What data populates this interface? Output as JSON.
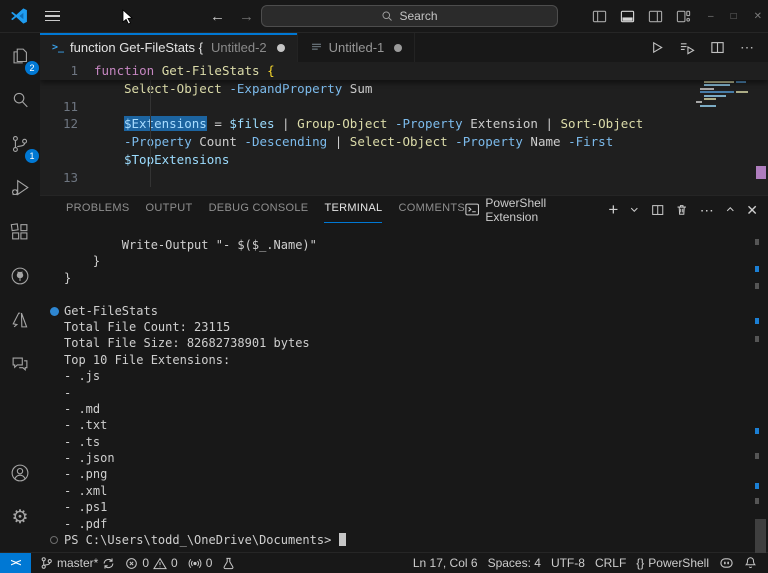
{
  "colors": {
    "accent": "#0078d4",
    "editor_bg": "#1f1f1f",
    "shell_bg": "#181818"
  },
  "title_bar": {
    "search_placeholder": "Search"
  },
  "activity_bar": {
    "explorer_badge": "2",
    "scm_badge": "1"
  },
  "tabs": {
    "tab1_title": "function Get-FileStats {",
    "tab1_file": "Untitled-2",
    "tab2_title": "Untitled-1"
  },
  "editor": {
    "rows": [
      {
        "num": "1",
        "sticky": true,
        "tokens": [
          [
            "kw",
            "function"
          ],
          [
            "pl",
            " "
          ],
          [
            "fn",
            "Get-FileStats"
          ],
          [
            "pl",
            " "
          ],
          [
            "br",
            "{"
          ]
        ]
      },
      {
        "num": "",
        "indent": true,
        "tokens": [
          [
            "fn",
            "Select-Object"
          ],
          [
            "pl",
            " "
          ],
          [
            "pm",
            "-ExpandProperty"
          ],
          [
            "pl",
            " Sum"
          ]
        ]
      },
      {
        "num": "11",
        "tokens": []
      },
      {
        "num": "12",
        "indent": true,
        "tokens": [
          [
            "vs",
            "$Extensions"
          ],
          [
            "pl",
            " = "
          ],
          [
            "vr",
            "$files"
          ],
          [
            "pl",
            " | "
          ],
          [
            "fn",
            "Group-Object"
          ],
          [
            "pl",
            " "
          ],
          [
            "pm",
            "-Property"
          ],
          [
            "pl",
            " Extension | "
          ],
          [
            "fn",
            "Sort-Object"
          ]
        ]
      },
      {
        "num": "",
        "indent": true,
        "tokens": [
          [
            "pm",
            "-Property"
          ],
          [
            "pl",
            " Count "
          ],
          [
            "pm",
            "-Descending"
          ],
          [
            "pl",
            " | "
          ],
          [
            "fn",
            "Select-Object"
          ],
          [
            "pl",
            " "
          ],
          [
            "pm",
            "-Property"
          ],
          [
            "pl",
            " Name "
          ],
          [
            "pm",
            "-First"
          ]
        ]
      },
      {
        "num": "",
        "indent": true,
        "tokens": [
          [
            "vr",
            "$TopExtensions"
          ]
        ]
      },
      {
        "num": "13",
        "tokens": []
      }
    ]
  },
  "panel": {
    "tabs": [
      {
        "label": "PROBLEMS",
        "active": false
      },
      {
        "label": "OUTPUT",
        "active": false
      },
      {
        "label": "DEBUG CONSOLE",
        "active": false
      },
      {
        "label": "TERMINAL",
        "active": true
      },
      {
        "label": "COMMENTS",
        "active": false
      }
    ],
    "terminal_name": "PowerShell Extension"
  },
  "terminal": {
    "lines": [
      {
        "text": "        Write-Output \"- $($_.Name)\""
      },
      {
        "text": "    }"
      },
      {
        "text": "}"
      },
      {
        "text": ""
      },
      {
        "dec": "blue",
        "text": "Get-FileStats"
      },
      {
        "text": "Total File Count: 23115"
      },
      {
        "text": "Total File Size: 82682738901 bytes"
      },
      {
        "text": "Top 10 File Extensions:"
      },
      {
        "text": "- .js"
      },
      {
        "text": "-"
      },
      {
        "text": "- .md"
      },
      {
        "text": "- .txt"
      },
      {
        "text": "- .ts"
      },
      {
        "text": "- .json"
      },
      {
        "text": "- .png"
      },
      {
        "text": "- .xml"
      },
      {
        "text": "- .ps1"
      },
      {
        "text": "- .pdf"
      },
      {
        "dec": "hollow",
        "cursor": true,
        "text": "PS C:\\Users\\todd_\\OneDrive\\Documents> "
      }
    ]
  },
  "status_bar": {
    "branch": "master*",
    "errors": "0",
    "warnings": "0",
    "ports": "0",
    "line_col": "Ln 17, Col 6",
    "indent": "Spaces: 4",
    "encoding": "UTF-8",
    "eol": "CRLF",
    "brackets": "{}",
    "language": "PowerShell"
  }
}
